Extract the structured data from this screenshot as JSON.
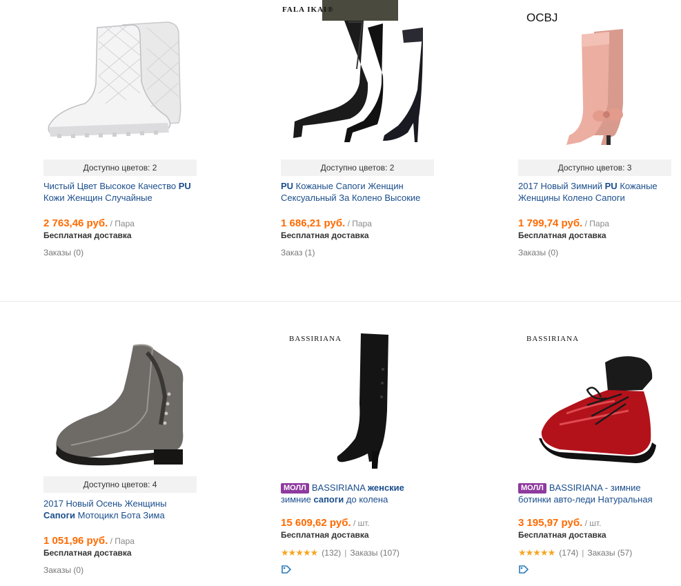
{
  "products": [
    {
      "colors": "Доступно цветов: 2",
      "title_pre": "Чистый Цвет Высокое Качество ",
      "title_bold": "PU",
      "title_post": " Кожи Женщин Случайные",
      "price": "2 763,46 руб.",
      "unit": " / Пара",
      "shipping": "Бесплатная доставка",
      "orders": "Заказы (0)"
    },
    {
      "brand": "FALA IKAI®",
      "colors": "Доступно цветов: 2",
      "title_pre": "",
      "title_bold": "PU",
      "title_post": " Кожаные Сапоги Женщин Сексуальный За Колено Высокие",
      "price": "1 686,21 руб.",
      "unit": " / Пара",
      "shipping": "Бесплатная доставка",
      "orders": "Заказ (1)"
    },
    {
      "brand": "OCBJ",
      "colors": "Доступно цветов: 3",
      "title_pre": "2017 Новый Зимний ",
      "title_bold": "PU",
      "title_post": " Кожаные Женщины Колено Сапоги",
      "price": "1 799,74 руб.",
      "unit": " / Пара",
      "shipping": "Бесплатная доставка",
      "orders": "Заказы (0)"
    },
    {
      "colors": "Доступно цветов: 4",
      "title_pre": "2017 Новый Осень Женщины ",
      "title_bold": "Сапоги",
      "title_post": " Мотоцикл Бота Зима",
      "price": "1 051,96 руб.",
      "unit": " / Пара",
      "shipping": "Бесплатная доставка",
      "orders": "Заказы (0)"
    },
    {
      "brand": "BASSIRIANA",
      "mall": "МОЛЛ",
      "title_pre": "BASSIRIANA ",
      "title_bold": "женские",
      "title_mid": " зимние ",
      "title_bold2": "сапоги",
      "title_post": " до колена",
      "price": "15 609,62 руб.",
      "unit": " / шт.",
      "shipping": "Бесплатная доставка",
      "rating": 5,
      "reviews": "(132)",
      "orders": "Заказы (107)"
    },
    {
      "brand": "BASSIRIANA",
      "mall": "МОЛЛ",
      "title_pre": "BASSIRIANA - зимние ботинки авто-леди Натуральная",
      "price": "3 195,97 руб.",
      "unit": " / шт.",
      "shipping": "Бесплатная доставка",
      "rating": 5,
      "reviews": "(174)",
      "orders": "Заказы (57)"
    }
  ],
  "colors": {
    "price": "#ff6a00",
    "link": "#1a4d8c",
    "mall_badge": "#8e3a9e",
    "stars": "#f5a623"
  },
  "icons": {
    "stars": "★★★★★",
    "coupon": "coupon-icon"
  }
}
